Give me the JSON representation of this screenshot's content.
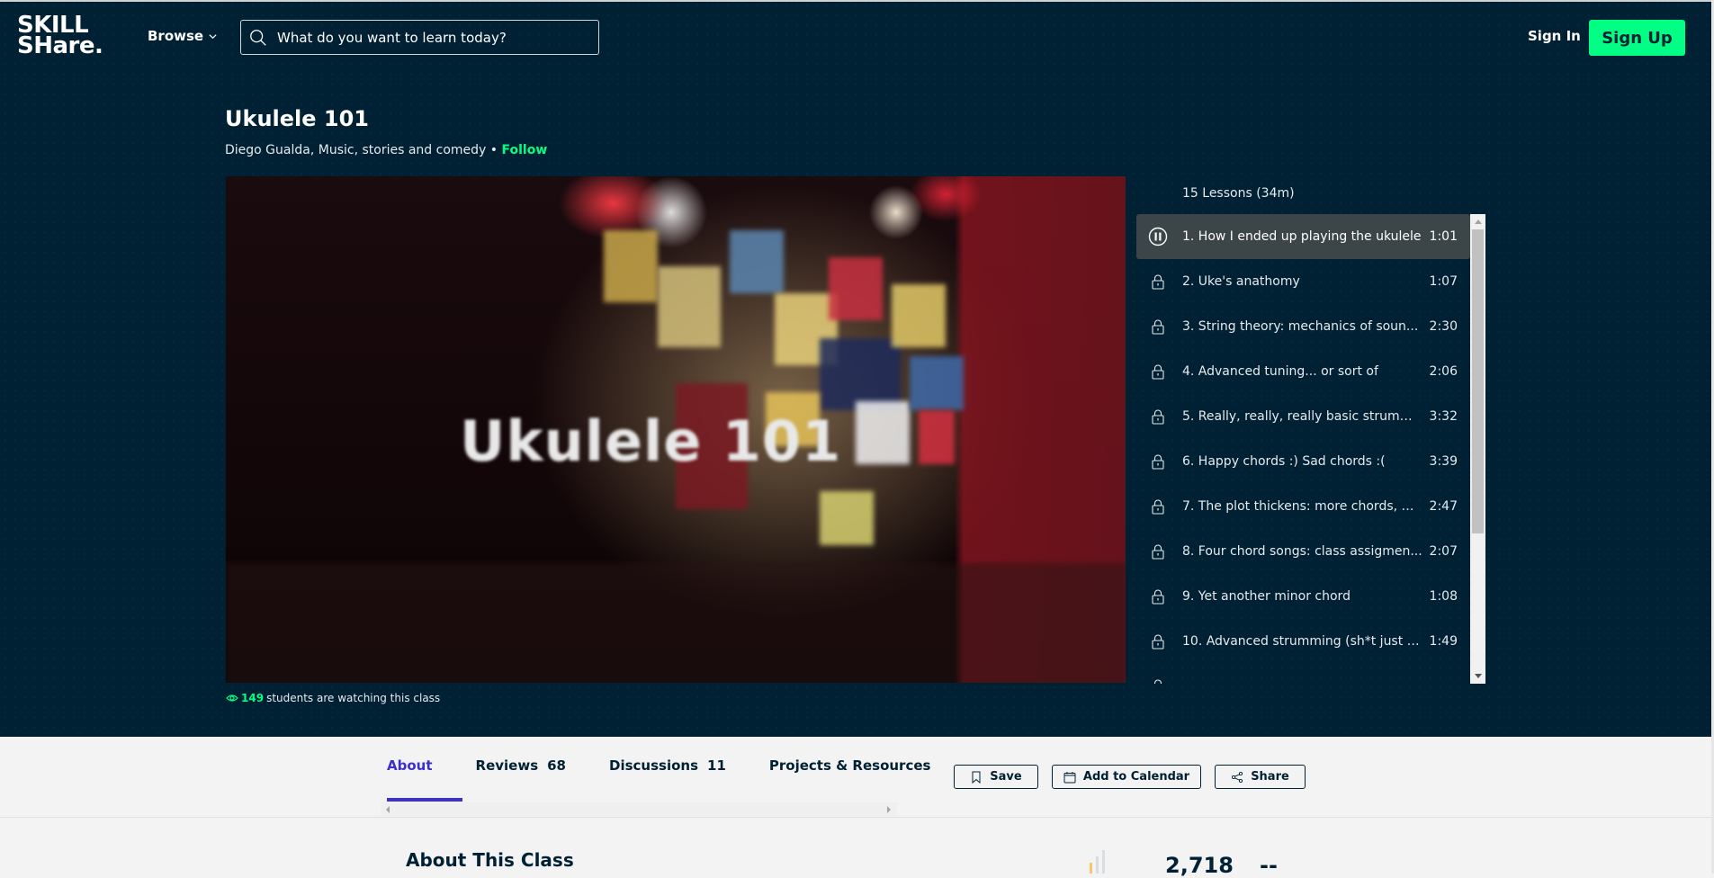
{
  "header": {
    "logo_line1": "SKILL",
    "logo_line2": "SHare.",
    "browse_label": "Browse",
    "search_placeholder": "What do you want to learn today?",
    "sign_in_label": "Sign In",
    "sign_up_label": "Sign Up"
  },
  "class": {
    "title": "Ukulele 101",
    "teacher": "Diego Gualda, Music, stories and comedy",
    "separator": " • ",
    "follow_label": "Follow",
    "video_overlay_text": "Ukulele 101",
    "watching_count": "149",
    "watching_text": "students are watching this class"
  },
  "lessons": {
    "summary": "15 Lessons (34m)",
    "items": [
      {
        "title": "1. How I ended up playing the ukulele",
        "duration": "1:01",
        "state": "playing",
        "icon": "pause-icon"
      },
      {
        "title": "2. Uke's anathomy",
        "duration": "1:07",
        "state": "locked",
        "icon": "lock-icon"
      },
      {
        "title": "3. String theory: mechanics of soun...",
        "duration": "2:30",
        "state": "locked",
        "icon": "lock-icon"
      },
      {
        "title": "4. Advanced tuning... or sort of",
        "duration": "2:06",
        "state": "locked",
        "icon": "lock-icon"
      },
      {
        "title": "5. Really, really, really basic strumm...",
        "duration": "3:32",
        "state": "locked",
        "icon": "lock-icon"
      },
      {
        "title": "6. Happy chords :) Sad chords :(",
        "duration": "3:39",
        "state": "locked",
        "icon": "lock-icon"
      },
      {
        "title": "7. The plot thickens: more chords, m...",
        "duration": "2:47",
        "state": "locked",
        "icon": "lock-icon"
      },
      {
        "title": "8. Four chord songs: class assigmen...",
        "duration": "2:07",
        "state": "locked",
        "icon": "lock-icon"
      },
      {
        "title": "9. Yet another minor chord",
        "duration": "1:08",
        "state": "locked",
        "icon": "lock-icon"
      },
      {
        "title": "10. Advanced strumming (sh*t just got...",
        "duration": "1:49",
        "state": "locked",
        "icon": "lock-icon"
      }
    ]
  },
  "tabs": [
    {
      "label": "About",
      "count": "",
      "active": true
    },
    {
      "label": "Reviews",
      "count": "68",
      "active": false
    },
    {
      "label": "Discussions",
      "count": "11",
      "active": false
    },
    {
      "label": "Projects & Resources",
      "count": "",
      "active": false
    }
  ],
  "actions": {
    "save_label": "Save",
    "calendar_label": "Add to Calendar",
    "share_label": "Share"
  },
  "about": {
    "heading": "About This Class",
    "stat_value": "2,718",
    "stat_secondary": "--"
  },
  "colors": {
    "hero_bg": "#002033",
    "accent_green": "#00ff84",
    "tab_active": "#3d2fcd",
    "active_lesson_bg": "#3c4648"
  }
}
